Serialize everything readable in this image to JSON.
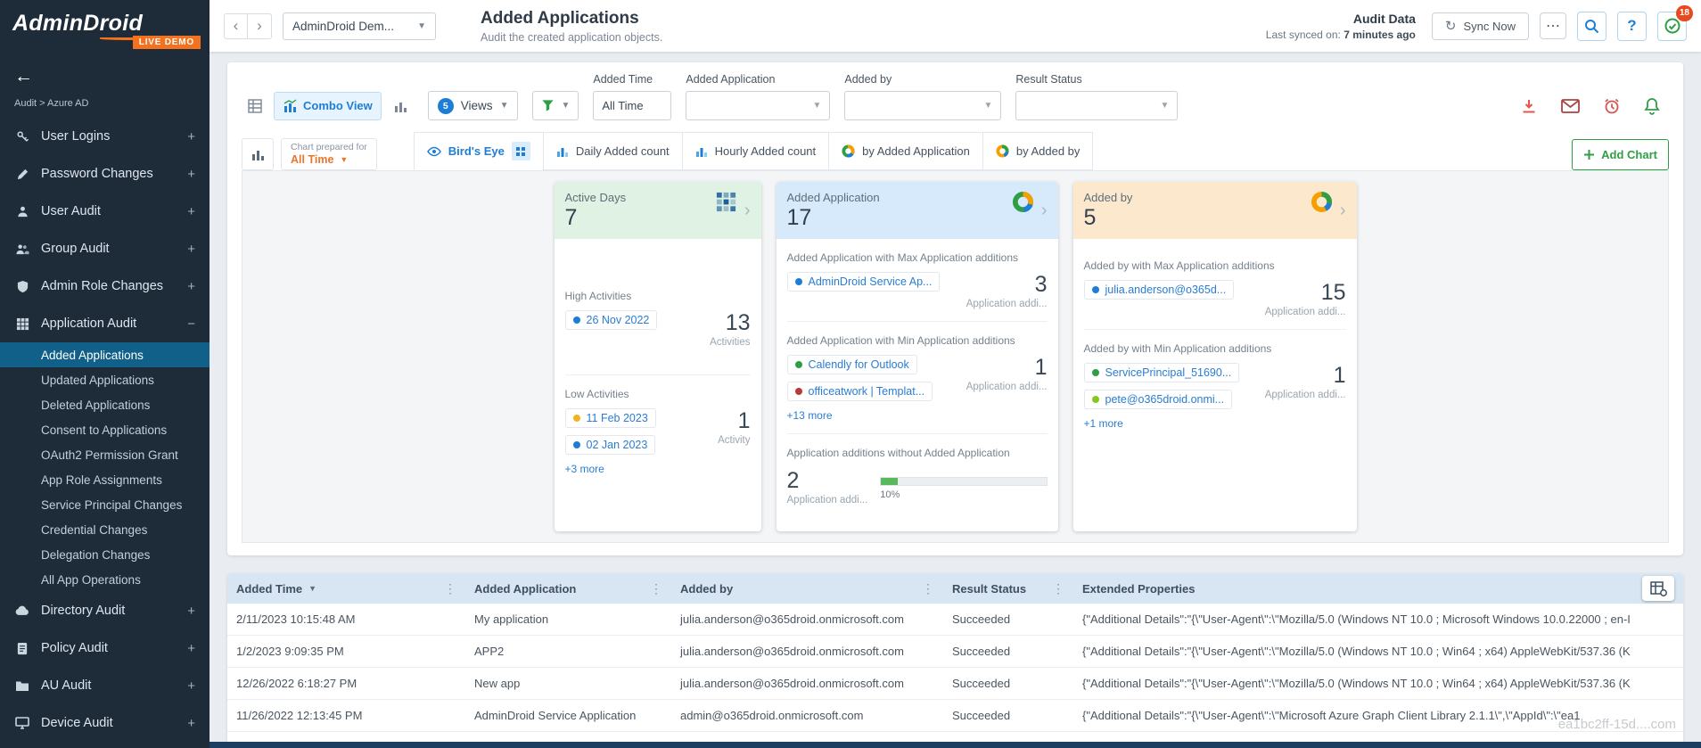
{
  "sidebar": {
    "logo": "AdminDroid",
    "live_badge": "LIVE DEMO",
    "back_icon": "←",
    "breadcrumb": "Audit > Azure AD",
    "items": [
      {
        "label": "User Logins",
        "expander": "+"
      },
      {
        "label": "Password Changes",
        "expander": "+"
      },
      {
        "label": "User Audit",
        "expander": "+"
      },
      {
        "label": "Group Audit",
        "expander": "+"
      },
      {
        "label": "Admin Role Changes",
        "expander": "+"
      },
      {
        "label": "Application Audit",
        "expander": "−"
      },
      {
        "label": "Directory Audit",
        "expander": "+"
      },
      {
        "label": "Policy Audit",
        "expander": "+"
      },
      {
        "label": "AU Audit",
        "expander": "+"
      },
      {
        "label": "Device Audit",
        "expander": "+"
      }
    ],
    "application_audit_children": [
      {
        "label": "Added Applications",
        "selected": true
      },
      {
        "label": "Updated Applications"
      },
      {
        "label": "Deleted Applications"
      },
      {
        "label": "Consent to Applications"
      },
      {
        "label": "OAuth2 Permission Grant"
      },
      {
        "label": "App Role Assignments"
      },
      {
        "label": "Service Principal Changes"
      },
      {
        "label": "Credential Changes"
      },
      {
        "label": "Delegation Changes"
      },
      {
        "label": "All App Operations"
      }
    ]
  },
  "topbar": {
    "nav_back": "‹",
    "nav_forward": "›",
    "tenant": "AdminDroid Dem...",
    "title": "Added Applications",
    "subtitle": "Audit the created application objects.",
    "audit_data_label": "Audit Data",
    "last_synced_label": "Last synced on:",
    "last_synced_value": "7 minutes ago",
    "sync_label": "Sync Now",
    "sync_icon": "↻",
    "more_icon": "⋯",
    "help_label": "?",
    "notification_count": "18"
  },
  "filters": {
    "combo_view_label": "Combo View",
    "views_count": "5",
    "views_label": "Views",
    "added_time": {
      "label": "Added Time",
      "value": "All Time"
    },
    "added_application": {
      "label": "Added Application",
      "value": ""
    },
    "added_by": {
      "label": "Added by",
      "value": ""
    },
    "result_status": {
      "label": "Result Status",
      "value": ""
    }
  },
  "chartbar": {
    "prepared_label": "Chart prepared for",
    "prepared_value": "All Time",
    "tabs": [
      {
        "label": "Bird's Eye",
        "selected": true
      },
      {
        "label": "Daily Added count"
      },
      {
        "label": "Hourly Added count"
      },
      {
        "label": "by Added Application"
      },
      {
        "label": "by Added by"
      }
    ],
    "add_chart_label": "Add Chart"
  },
  "cards": [
    {
      "title": "Active Days",
      "value": "7",
      "sections": [
        {
          "label": "High Activities",
          "items": [
            {
              "text": "26 Nov 2022",
              "color": "#1c7ed6"
            }
          ],
          "value": "13",
          "unit": "Activities"
        },
        {
          "label": "Low Activities",
          "items": [
            {
              "text": "11 Feb 2023",
              "color": "#f0b41e"
            },
            {
              "text": "02 Jan 2023",
              "color": "#1c7ed6"
            }
          ],
          "value": "1",
          "unit": "Activity",
          "more": "+3 more"
        }
      ]
    },
    {
      "title": "Added Application",
      "value": "17",
      "sections": [
        {
          "label": "Added Application with Max Application additions",
          "items": [
            {
              "text": "AdminDroid Service Ap...",
              "color": "#1c7ed6"
            }
          ],
          "value": "3",
          "unit": "Application addi..."
        },
        {
          "label": "Added Application with Min Application additions",
          "items": [
            {
              "text": "Calendly for Outlook",
              "color": "#2f9e44"
            },
            {
              "text": "officeatwork | Templat...",
              "color": "#b23b3b"
            }
          ],
          "value": "1",
          "unit": "Application addi...",
          "more": "+13 more"
        },
        {
          "label": "Application additions without Added Application",
          "value": "2",
          "unit": "Application addi...",
          "percent": 10,
          "percent_label": "10%"
        }
      ]
    },
    {
      "title": "Added by",
      "value": "5",
      "sections": [
        {
          "label": "Added by with Max Application additions",
          "items": [
            {
              "text": "julia.anderson@o365d...",
              "color": "#1c7ed6"
            }
          ],
          "value": "15",
          "unit": "Application addi..."
        },
        {
          "label": "Added by with Min Application additions",
          "items": [
            {
              "text": "ServicePrincipal_51690...",
              "color": "#2f9e44"
            },
            {
              "text": "pete@o365droid.onmi...",
              "color": "#82c91e"
            }
          ],
          "value": "1",
          "unit": "Application addi...",
          "more": "+1 more"
        }
      ]
    }
  ],
  "table": {
    "columns": [
      {
        "label": "Added Time",
        "sort": "▼"
      },
      {
        "label": "Added Application"
      },
      {
        "label": "Added by"
      },
      {
        "label": "Result Status"
      },
      {
        "label": "Extended Properties"
      }
    ],
    "rows": [
      {
        "cells": [
          "2/11/2023 10:15:48 AM",
          "My application",
          "julia.anderson@o365droid.onmicrosoft.com",
          "Succeeded",
          "{\"Additional Details\":\"{\\\"User-Agent\\\":\\\"Mozilla/5.0 (Windows NT 10.0 ; Microsoft Windows 10.0.22000 ; en-I"
        ]
      },
      {
        "cells": [
          "1/2/2023 9:09:35 PM",
          "APP2",
          "julia.anderson@o365droid.onmicrosoft.com",
          "Succeeded",
          "{\"Additional Details\":\"{\\\"User-Agent\\\":\\\"Mozilla/5.0 (Windows NT 10.0 ; Win64 ; x64) AppleWebKit/537.36 (K"
        ]
      },
      {
        "cells": [
          "12/26/2022 6:18:27 PM",
          "New app",
          "julia.anderson@o365droid.onmicrosoft.com",
          "Succeeded",
          "{\"Additional Details\":\"{\\\"User-Agent\\\":\\\"Mozilla/5.0 (Windows NT 10.0 ; Win64 ; x64) AppleWebKit/537.36 (K"
        ]
      },
      {
        "cells": [
          "11/26/2022 12:13:45 PM",
          "AdminDroid Service Application",
          "admin@o365droid.onmicrosoft.com",
          "Succeeded",
          "{\"Additional Details\":\"{\\\"User-Agent\\\":\\\"Microsoft Azure Graph Client Library 2.1.1\\\",\\\"AppId\\\":\\\"ea1"
        ]
      }
    ]
  },
  "watermark": "ea1bc2ff-15d....com"
}
